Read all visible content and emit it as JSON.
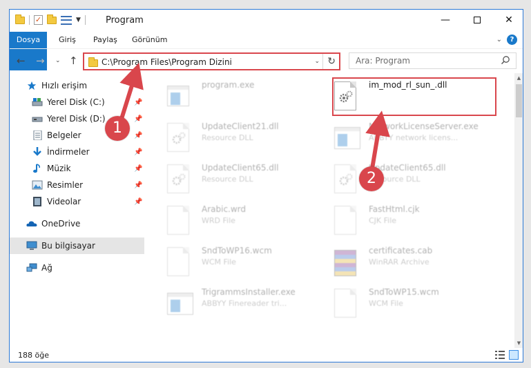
{
  "titlebar": {
    "title": "Program",
    "minimize": "—",
    "close": "✕"
  },
  "ribbon": {
    "tabs": [
      "Dosya",
      "Giriş",
      "Paylaş",
      "Görünüm"
    ],
    "help": "?"
  },
  "nav": {
    "address": "C:\\Program Files\\Program Dizini",
    "search_placeholder": "Ara: Program"
  },
  "sidebar": {
    "items": [
      {
        "label": "Hızlı erişim",
        "icon": "star-icon",
        "pinned": false
      },
      {
        "label": "Yerel Disk (C:)",
        "icon": "drive-c-icon",
        "pinned": true
      },
      {
        "label": "Yerel Disk (D:)",
        "icon": "drive-d-icon",
        "pinned": true
      },
      {
        "label": "Belgeler",
        "icon": "documents-icon",
        "pinned": true
      },
      {
        "label": "İndirmeler",
        "icon": "downloads-icon",
        "pinned": true
      },
      {
        "label": "Müzik",
        "icon": "music-icon",
        "pinned": true
      },
      {
        "label": "Resimler",
        "icon": "pictures-icon",
        "pinned": true
      },
      {
        "label": "Videolar",
        "icon": "videos-icon",
        "pinned": true
      },
      {
        "label": "OneDrive",
        "icon": "onedrive-icon",
        "pinned": false
      },
      {
        "label": "Bu bilgisayar",
        "icon": "this-pc-icon",
        "pinned": false
      },
      {
        "label": "Ağ",
        "icon": "network-icon",
        "pinned": false
      }
    ]
  },
  "files": [
    {
      "name": "program.exe",
      "type": "",
      "icon": "program-exe-icon",
      "faded": true
    },
    {
      "name": "im_mod_rl_sun_.dll",
      "type": "",
      "icon": "dll-gear-icon",
      "faded": false
    },
    {
      "name": "UpdateClient21.dll",
      "type": "Resource DLL",
      "icon": "dll-gear-icon",
      "faded": true
    },
    {
      "name": "NetworkLicenseServer.exe",
      "type": "ABBYY network licens...",
      "icon": "exe-window-icon",
      "faded": true
    },
    {
      "name": "UpdateClient65.dll",
      "type": "Resource DLL",
      "icon": "dll-gear-icon",
      "faded": true
    },
    {
      "name": "UpdateClient65.dll",
      "type": "Resource DLL",
      "icon": "dll-gear-icon",
      "faded": true
    },
    {
      "name": "Arabic.wrd",
      "type": "WRD File",
      "icon": "blank-document-icon",
      "faded": true
    },
    {
      "name": "FastHtml.cjk",
      "type": "CJK File",
      "icon": "blank-document-icon",
      "faded": true
    },
    {
      "name": "SndToWP16.wcm",
      "type": "WCM File",
      "icon": "blank-document-icon",
      "faded": true
    },
    {
      "name": "certificates.cab",
      "type": "WinRAR Archive",
      "icon": "winrar-archive-icon",
      "faded": true
    },
    {
      "name": "TrigrammsInstaller.exe",
      "type": "ABBYY Finereader tri...",
      "icon": "exe-window-icon",
      "faded": true
    },
    {
      "name": "SndToWP15.wcm",
      "type": "WCM File",
      "icon": "blank-document-icon",
      "faded": true
    }
  ],
  "status": {
    "count": "188 öğe"
  },
  "annotations": {
    "callout1": "1",
    "callout2": "2",
    "color": "#d9464c"
  },
  "colors": {
    "accent": "#1979ca",
    "highlight": "#d9464c",
    "selected": "#cce8ff"
  }
}
